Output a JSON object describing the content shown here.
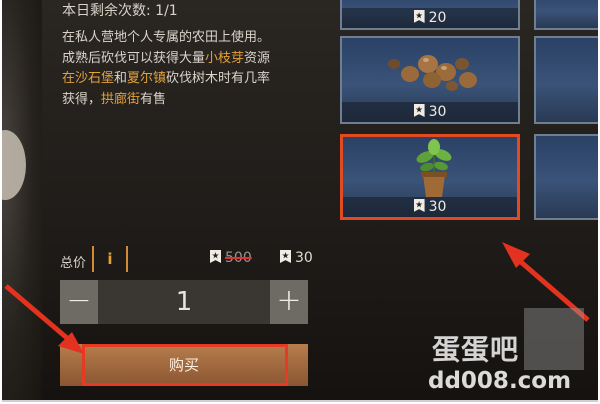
{
  "remaining_label": "本日剩余次数: 1/1",
  "description": {
    "line1": "在私人营地个人专属的农田上使用。",
    "line2_pre": "成熟后砍伐可以获得大量",
    "line2_hl": "小枝芽",
    "line2_post": "资源",
    "line3_hl1": "在沙石堡",
    "line3_mid": "和",
    "line3_hl2": "夏尔镇",
    "line3_post": "砍伐树木时有几率",
    "line4_pre": "获得，",
    "line4_hl": "拱廊街",
    "line4_post": "有售"
  },
  "total": {
    "label": "总价",
    "info_icon_text": "i",
    "old_price": "500",
    "new_price": "30"
  },
  "quantity": {
    "minus": "−",
    "value": "1",
    "plus": "+"
  },
  "buy_button": "购买",
  "items": [
    {
      "price": "20",
      "icon": "item-top"
    },
    {
      "price": "30",
      "icon": "walnuts-icon"
    },
    {
      "price": "30",
      "icon": "sapling-pot-icon"
    }
  ],
  "watermark": {
    "logo": "蛋蛋吧",
    "url": "dd008.com"
  },
  "colors": {
    "highlight": "#e3a13c",
    "selection": "#e24a22",
    "arrow": "#e3321f"
  }
}
